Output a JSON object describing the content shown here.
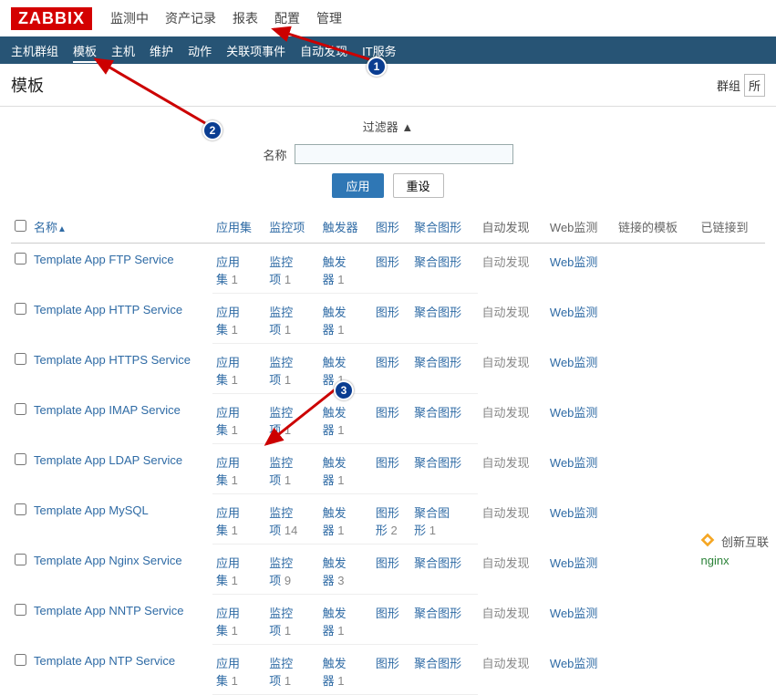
{
  "logo": "ZABBIX",
  "top_nav": {
    "items": [
      "监测中",
      "资产记录",
      "报表",
      "配置",
      "管理"
    ]
  },
  "sub_nav": {
    "items": [
      "主机群组",
      "模板",
      "主机",
      "维护",
      "动作",
      "关联项事件",
      "自动发现",
      "IT服务"
    ],
    "active_index": 1
  },
  "page_title": "模板",
  "group_filter_label": "群组",
  "group_filter_value": "所",
  "filter_toggle_label": "过滤器 ▲",
  "filter": {
    "name_label": "名称",
    "name_value": "",
    "apply_label": "应用",
    "reset_label": "重设"
  },
  "table": {
    "headers": {
      "name": "名称",
      "appset": "应用集",
      "items": "监控项",
      "triggers": "触发器",
      "graphs": "图形",
      "screens": "聚合图形",
      "discovery": "自动发现",
      "web": "Web监测",
      "linked_template": "链接的模板",
      "linked_to": "已链接到"
    },
    "sort_indicator": "▲",
    "rows": [
      {
        "name": "Template App FTP Service",
        "appset": "应⽤集",
        "appset_count": "1",
        "items": "监控项",
        "items_count": "1",
        "triggers": "触发器",
        "triggers_count": "1",
        "graphs": "图形",
        "graphs_count": "",
        "screens": "聚合图形",
        "discovery": "自动发现",
        "web": "Web监测",
        "linked_to": ""
      },
      {
        "name": "Template App HTTP Service",
        "appset": "应⽤集",
        "appset_count": "1",
        "items": "监控项",
        "items_count": "1",
        "triggers": "触发器",
        "triggers_count": "1",
        "graphs": "图形",
        "graphs_count": "",
        "screens": "聚合图形",
        "discovery": "自动发现",
        "web": "Web监测",
        "linked_to": ""
      },
      {
        "name": "Template App HTTPS Service",
        "appset": "应⽤集",
        "appset_count": "1",
        "items": "监控项",
        "items_count": "1",
        "triggers": "触发器",
        "triggers_count": "1",
        "graphs": "图形",
        "graphs_count": "",
        "screens": "聚合图形",
        "discovery": "自动发现",
        "web": "Web监测",
        "linked_to": ""
      },
      {
        "name": "Template App IMAP Service",
        "appset": "应⽤集",
        "appset_count": "1",
        "items": "监控项",
        "items_count": "1",
        "triggers": "触发器",
        "triggers_count": "1",
        "graphs": "图形",
        "graphs_count": "",
        "screens": "聚合图形",
        "discovery": "自动发现",
        "web": "Web监测",
        "linked_to": ""
      },
      {
        "name": "Template App LDAP Service",
        "appset": "应⽤集",
        "appset_count": "1",
        "items": "监控项",
        "items_count": "1",
        "triggers": "触发器",
        "triggers_count": "1",
        "graphs": "图形",
        "graphs_count": "",
        "screens": "聚合图形",
        "discovery": "自动发现",
        "web": "Web监测",
        "linked_to": ""
      },
      {
        "name": "Template App MySQL",
        "appset": "应⽤集",
        "appset_count": "1",
        "items": "监控项",
        "items_count": "14",
        "triggers": "触发器",
        "triggers_count": "1",
        "graphs": "图形",
        "graphs_count": "2",
        "screens": "聚合图形",
        "screens_count": "1",
        "discovery": "自动发现",
        "web": "Web监测",
        "linked_to": ""
      },
      {
        "name": "Template App Nginx Service",
        "appset": "应⽤集",
        "appset_count": "1",
        "items": "监控项",
        "items_count": "9",
        "triggers": "触发器",
        "triggers_count": "3",
        "graphs": "图形",
        "graphs_count": "",
        "screens": "聚合图形",
        "discovery": "自动发现",
        "web": "Web监测",
        "linked_to": "nginx"
      },
      {
        "name": "Template App NNTP Service",
        "appset": "应⽤集",
        "appset_count": "1",
        "items": "监控项",
        "items_count": "1",
        "triggers": "触发器",
        "triggers_count": "1",
        "graphs": "图形",
        "graphs_count": "",
        "screens": "聚合图形",
        "discovery": "自动发现",
        "web": "Web监测",
        "linked_to": ""
      },
      {
        "name": "Template App NTP Service",
        "appset": "应⽤集",
        "appset_count": "1",
        "items": "监控项",
        "items_count": "1",
        "triggers": "触发器",
        "triggers_count": "1",
        "graphs": "图形",
        "graphs_count": "",
        "screens": "聚合图形",
        "discovery": "自动发现",
        "web": "Web监测",
        "linked_to": ""
      }
    ]
  },
  "annotations": {
    "badge1": "1",
    "badge2": "2",
    "badge3": "3"
  },
  "watermark": "创新互联"
}
